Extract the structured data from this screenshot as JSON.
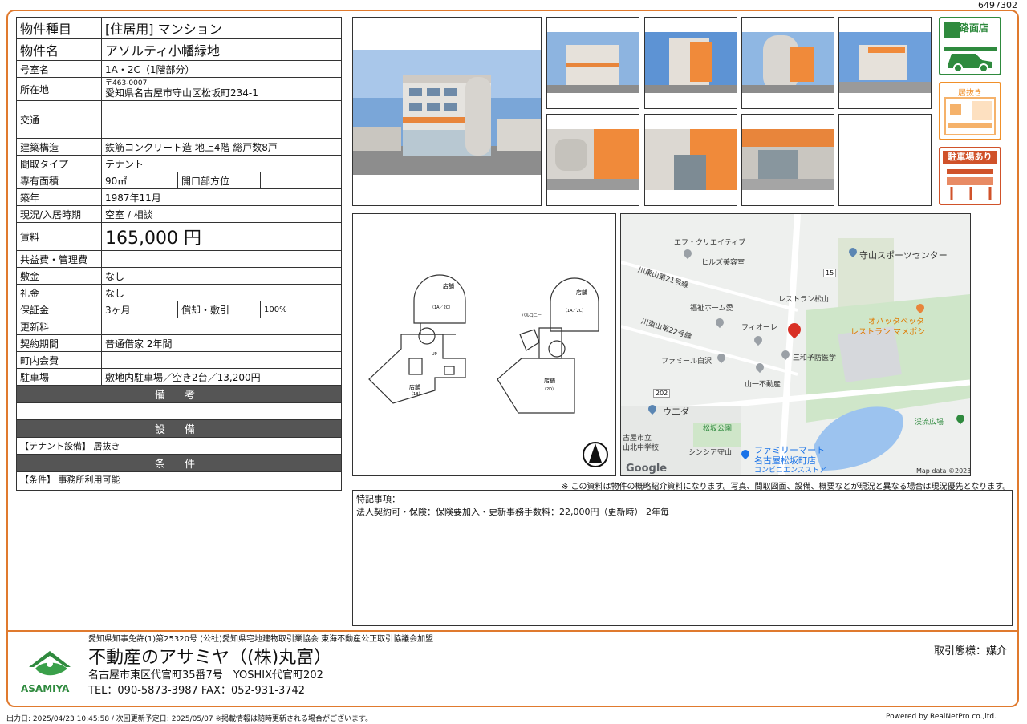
{
  "doc_no": "6497302",
  "spec": {
    "type_label": "物件種目",
    "type_value": "[住居用] マンション",
    "name_label": "物件名",
    "name_value": "アソルティ小幡緑地",
    "room_label": "号室名",
    "room_value": "1A・2C（1階部分）",
    "addr_label": "所在地",
    "postal": "〒463-0007",
    "addr_value": "愛知県名古屋市守山区松坂町234-1",
    "traffic_label": "交通",
    "traffic_value": "",
    "structure_label": "建築構造",
    "structure_value": "鉄筋コンクリート造 地上4階 総戸数8戸",
    "layout_label": "間取タイプ",
    "layout_value": "テナント",
    "area_label": "専有面積",
    "area_value": "90㎡",
    "direction_label": "開口部方位",
    "direction_value": "",
    "built_label": "築年",
    "built_value": "1987年11月",
    "status_label": "現況/入居時期",
    "status_value": "空室 / 相談",
    "rent_label": "賃料",
    "rent_value": "165,000 円",
    "fee_label": "共益費・管理費",
    "fee_value": "",
    "deposit_label": "敷金",
    "deposit_value": "なし",
    "key_label": "礼金",
    "key_value": "なし",
    "guarantee_label": "保証金",
    "guarantee_value": "3ヶ月",
    "amort_label": "償却・敷引",
    "amort_value": "100%",
    "renew_label": "更新料",
    "renew_value": "",
    "contract_label": "契約期間",
    "contract_value": "普通借家 2年間",
    "town_label": "町内会費",
    "town_value": "",
    "parking_label": "駐車場",
    "parking_value": "敷地内駐車場／空き2台／13,200円"
  },
  "sections": {
    "remarks_title": "備 考",
    "equipment_title": "設 備",
    "equipment_text": "【テナント設備】 居抜き",
    "conditions_title": "条 件",
    "conditions_text": "【条件】 事務所利用可能"
  },
  "badges": {
    "road": "路面店",
    "inugi": "居抜き",
    "parking": "駐車場あり"
  },
  "floorplan": {
    "shop1": "店舗",
    "unit1": "（1A／2C）",
    "shop2": "店舗",
    "unit2": "（1A／2C）",
    "shop3": "店舗",
    "unit3": "（1B）",
    "shop4": "店舗",
    "unit4": "（2D）",
    "up": "UP",
    "balcony": "バルコニー"
  },
  "map": {
    "labels": [
      "エフ・クリエイティブ",
      "ヒルズ美容室",
      "守山スポーツセンター",
      "川東山第21号線",
      "福祉ホーム愛",
      "レストラン松山",
      "オバッタベッタ",
      "レストラン マメポシ",
      "川東山第22号線",
      "フィオーレ",
      "三和予防医学",
      "ファミール白沢",
      "山一不動産",
      "ウエダ",
      "松坂公園",
      "渓流広場",
      "古屋市立",
      "山北中学校",
      "シンシア守山",
      "ファミリーマート",
      "名古屋松坂町店",
      "コンビニエンスストア",
      "Google",
      "Map data ©2023"
    ],
    "road_15": "15",
    "road_202": "202"
  },
  "notice": "※ この資料は物件の概略紹介資料になります。写真、間取図面、設備、概要などが現況と異なる場合は現況優先となります。",
  "special": {
    "title": "特記事項：",
    "text": "法人契約可・保険：保険要加入・更新事務手数料：22,000円（更新時） 2年毎"
  },
  "footer": {
    "license": "愛知県知事免許(1)第25320号 (公社)愛知県宅地建物取引業協会 東海不動産公正取引協議会加盟",
    "company": "不動産のアサミヤ（(株)丸富）",
    "address": "名古屋市東区代官町35番7号　YOSHIX代官町202",
    "tel": "TEL：090-5873-3987 FAX：052-931-3742",
    "deal": "取引態様：媒介",
    "logo": "ASAMIYA",
    "print": "出力日: 2025/04/23 10:45:58 /  次回更新予定日: 2025/05/07 ※掲載情報は随時更新される場合がございます。",
    "powered": "Powered by RealNetPro co.,ltd."
  },
  "colors": {
    "frame": "#e07a2e",
    "green": "#2f8a3e",
    "orange": "#f0902a",
    "section": "#555555",
    "red_pin": "#d93025"
  }
}
